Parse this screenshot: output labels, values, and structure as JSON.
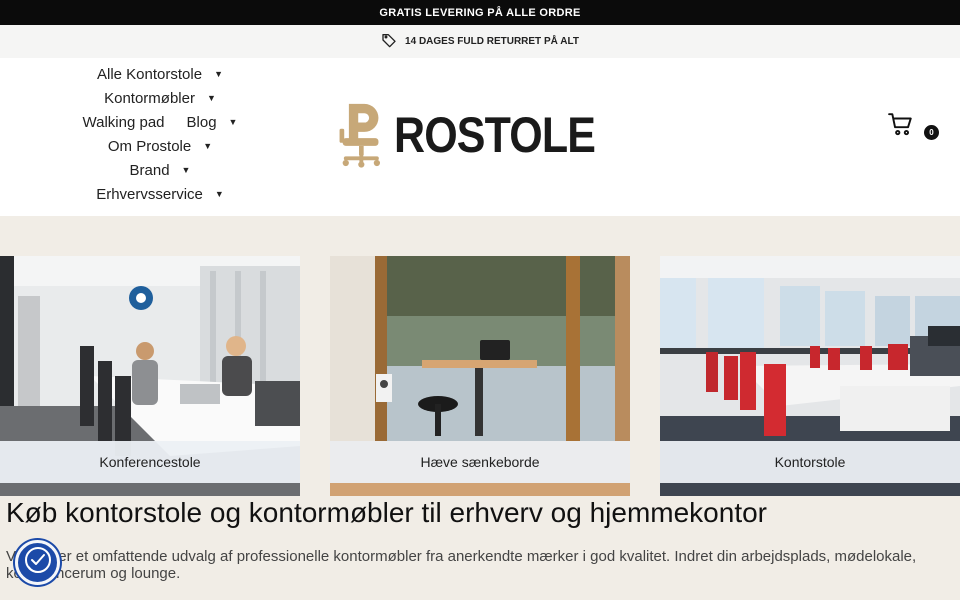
{
  "announcement": {
    "text": "GRATIS LEVERING PÅ ALLE ORDRE"
  },
  "subbar": {
    "icon": "tag-icon",
    "text": "14 DAGES FULD RETURRET PÅ ALT"
  },
  "nav": {
    "items": [
      {
        "label": "Alle Kontorstole",
        "dropdown": true
      },
      {
        "label": "Kontormøbler",
        "dropdown": true
      },
      {
        "label": "Walking pad",
        "dropdown": false
      },
      {
        "label": "Blog",
        "dropdown": true
      },
      {
        "label": "Om Prostole",
        "dropdown": true
      },
      {
        "label": "Brand",
        "dropdown": true
      },
      {
        "label": "Erhvervsservice",
        "dropdown": true
      }
    ],
    "caret": "▼"
  },
  "logo": {
    "text": "ROSTOLE",
    "icon": "chair-p-logo",
    "color": "#c7a878"
  },
  "cart": {
    "icon": "cart-icon",
    "count": "0"
  },
  "categories": [
    {
      "label": "Konferencestole"
    },
    {
      "label": "Hæve sænkeborde"
    },
    {
      "label": "Kontorstole"
    }
  ],
  "content": {
    "headline": "Køb kontorstole og kontormøbler til erhverv og hjemmekontor",
    "intro": "Vi tilbyder et omfattende udvalg af professionelle kontormøbler fra anerkendte mærker i god kvalitet. Indret din arbejdsplads, mødelokale, konferencerum og lounge."
  },
  "accessibility_badge": {
    "icon": "accessibility-check-icon"
  },
  "colors": {
    "background": "#f1ede6",
    "topbar": "#0b0b0b",
    "badge": "#1c4aa8"
  }
}
